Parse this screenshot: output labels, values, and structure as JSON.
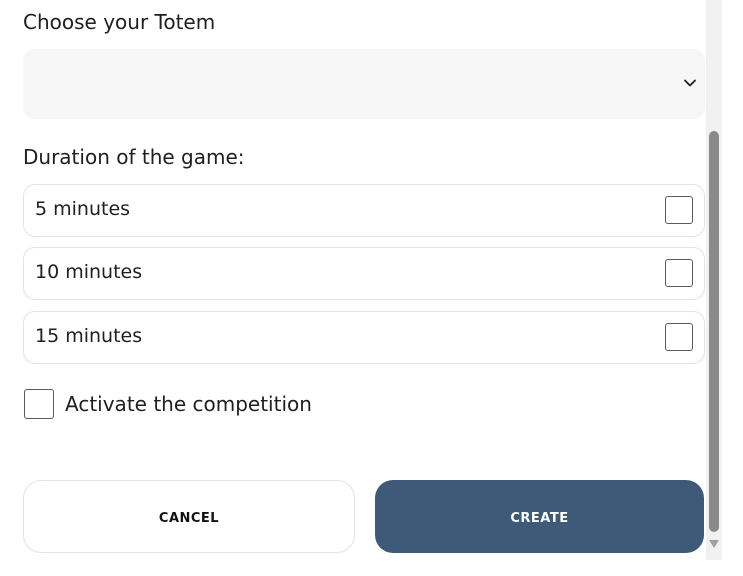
{
  "totem": {
    "label": "Choose your Totem",
    "selected_value": ""
  },
  "duration": {
    "label": "Duration of the game:",
    "options": [
      {
        "label": "5 minutes",
        "checked": false
      },
      {
        "label": "10 minutes",
        "checked": false
      },
      {
        "label": "15 minutes",
        "checked": false
      }
    ]
  },
  "competition": {
    "label": "Activate the competition",
    "checked": false
  },
  "actions": {
    "cancel_label": "Cancel",
    "create_label": "Create"
  },
  "colors": {
    "primary_button": "#3e5a78",
    "select_background": "#f7f7f7"
  },
  "icons": {
    "select_toggle": "chevron-down-icon",
    "scroll_down": "scroll-down-arrow-icon"
  }
}
